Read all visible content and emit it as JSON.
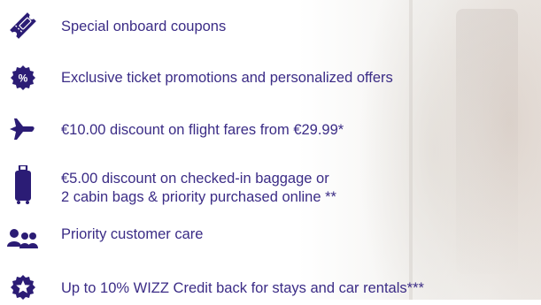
{
  "brand_color": "#2b1c75",
  "text_color": "#3b2c86",
  "benefits": [
    {
      "icon": "ticket-icon",
      "text": "Special onboard coupons"
    },
    {
      "icon": "percent-badge-icon",
      "text": "Exclusive ticket promotions and personalized offers"
    },
    {
      "icon": "airplane-icon",
      "text": "€10.00 discount on flight fares from €29.99*"
    },
    {
      "icon": "suitcase-icon",
      "line1": "€5.00 discount on checked-in baggage or",
      "line2": "2 cabin bags & priority purchased online **"
    },
    {
      "icon": "customer-care-icon",
      "text": "Priority customer care"
    },
    {
      "icon": "star-badge-icon",
      "text": "Up to 10% WIZZ Credit back for stays and car rentals***"
    }
  ]
}
